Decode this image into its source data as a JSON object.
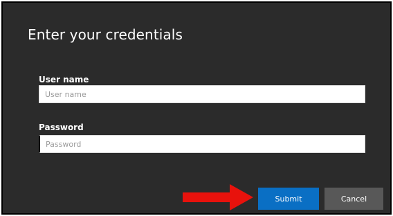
{
  "dialog": {
    "title": "Enter your credentials",
    "username": {
      "label": "User name",
      "placeholder": "User name",
      "value": ""
    },
    "password": {
      "label": "Password",
      "placeholder": "Password",
      "value": ""
    },
    "submit_label": "Submit",
    "cancel_label": "Cancel"
  },
  "colors": {
    "dialog_bg": "#2b2b2b",
    "submit_bg": "#0a6fc4",
    "cancel_bg": "#585858",
    "annotation_arrow": "#e8120c"
  },
  "annotations": {
    "arrow_icon": "right-arrow-icon"
  }
}
